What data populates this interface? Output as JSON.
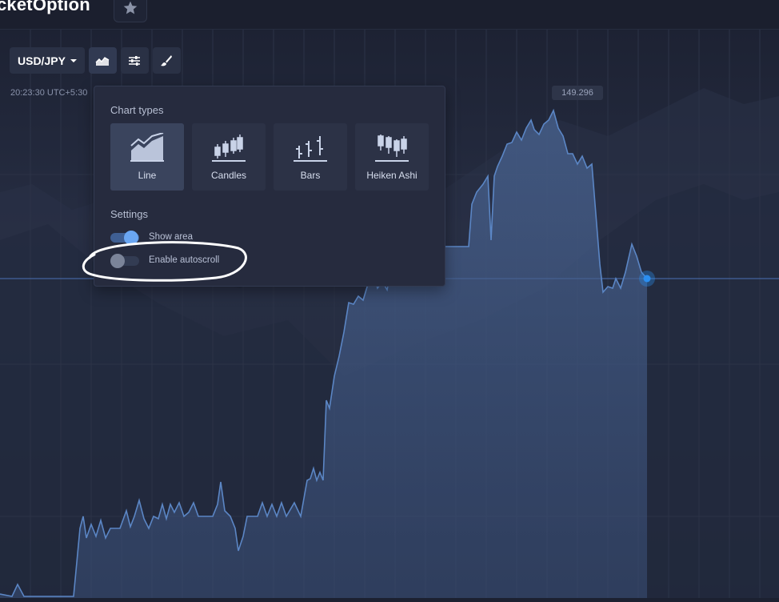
{
  "header": {
    "logo_text": "cketOption",
    "favorite_icon": "star-icon"
  },
  "toolbar": {
    "pair_label": "USD/JPY",
    "chart_type_icon": "area-chart-icon",
    "indicators_icon": "sliders-icon",
    "drawing_icon": "brush-icon"
  },
  "chart": {
    "timestamp": "20:23:30 UTC+5:30",
    "price_label": "149.296",
    "line_color": "#5b86c5",
    "current_point_color": "#2b8ef0"
  },
  "popup": {
    "chart_types_title": "Chart types",
    "types": [
      {
        "label": "Line",
        "icon": "line-chart-icon",
        "active": true
      },
      {
        "label": "Candles",
        "icon": "candles-icon",
        "active": false
      },
      {
        "label": "Bars",
        "icon": "bars-icon",
        "active": false
      },
      {
        "label": "Heiken Ashi",
        "icon": "heiken-ashi-icon",
        "active": false
      }
    ],
    "settings_title": "Settings",
    "settings": [
      {
        "label": "Show area",
        "on": true
      },
      {
        "label": "Enable autoscroll",
        "on": false
      }
    ]
  },
  "annotation_color": "#ffffff"
}
